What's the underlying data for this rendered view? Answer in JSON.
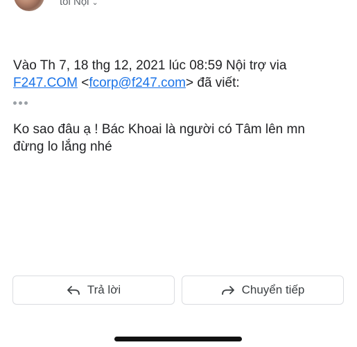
{
  "header": {
    "recipient_label": "tôi Nội"
  },
  "message": {
    "quote_intro": "Vào Th 7, 18 thg 12, 2021 lúc 08:59 Nội trợ via",
    "sender_link": "F247.COM",
    "email_open": "<",
    "email": "fcorp@f247.com",
    "email_close": ">",
    "wrote": "đã viết:",
    "body": "Ko sao đâu ạ ! Bác Khoai là người có Tâm lên mn đừng lo lắng nhé"
  },
  "actions": {
    "reply_label": "Trả lời",
    "forward_label": "Chuyển tiếp"
  },
  "icons": {
    "avatar": "avatar",
    "chevron": "chevron-down-icon",
    "ellipsis": "ellipsis-icon",
    "reply": "reply-icon",
    "forward": "forward-icon"
  },
  "colors": {
    "link": "#1a73e8",
    "text": "#202124",
    "muted": "#5f6368",
    "border": "#dadce0"
  }
}
